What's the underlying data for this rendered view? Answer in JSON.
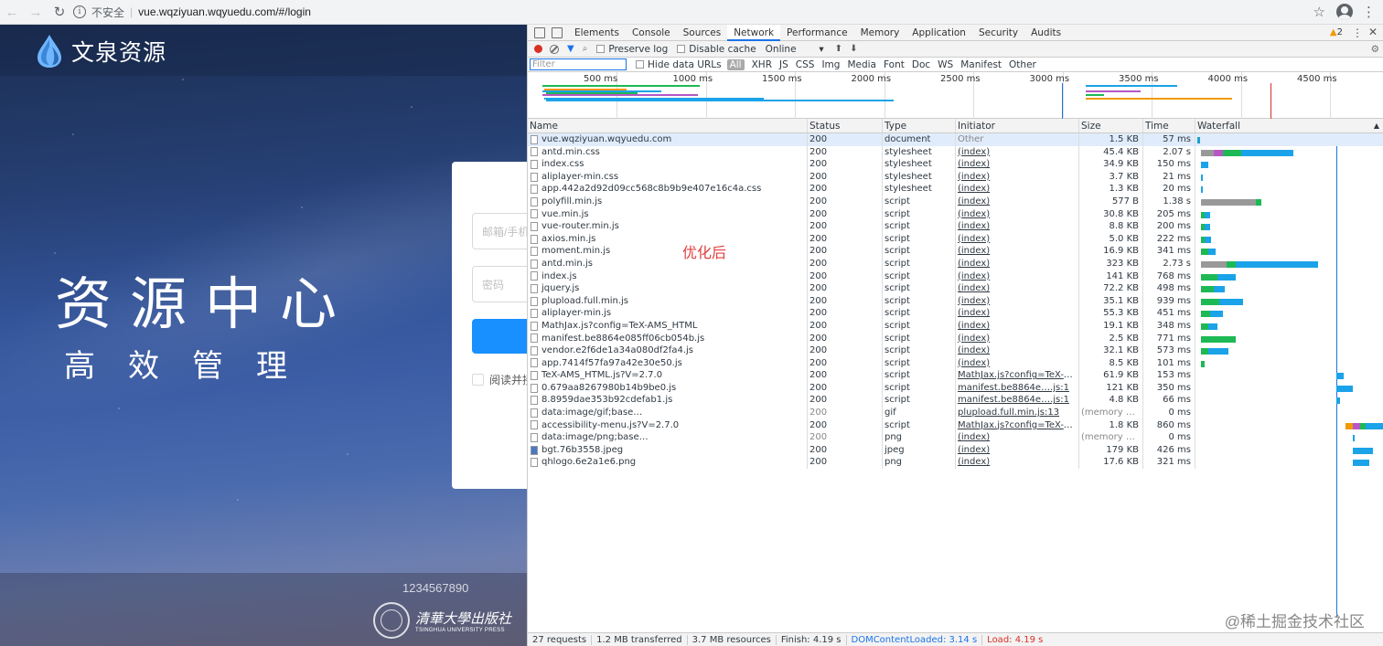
{
  "browser": {
    "insecure_label": "不安全",
    "url": "vue.wqziyuan.wqyuedu.com/#/login"
  },
  "page": {
    "brand_name": "文泉资源",
    "hero_line1": "资源中心",
    "hero_line2": "高效管理",
    "email_placeholder": "邮箱/手机",
    "password_placeholder": "密码",
    "agree_text": "阅读并接",
    "phone": "1234567890",
    "press_cn": "清華大學出版社",
    "press_en": "TSINGHUA UNIVERSITY PRESS"
  },
  "devtools": {
    "tabs": [
      "Elements",
      "Console",
      "Sources",
      "Network",
      "Performance",
      "Memory",
      "Application",
      "Security",
      "Audits"
    ],
    "warning_count": "2",
    "preserve_log": "Preserve log",
    "disable_cache": "Disable cache",
    "throttle": "Online",
    "filter_placeholder": "Filter",
    "hide_data_urls": "Hide data URLs",
    "types": [
      "All",
      "XHR",
      "JS",
      "CSS",
      "Img",
      "Media",
      "Font",
      "Doc",
      "WS",
      "Manifest",
      "Other"
    ],
    "overview_ticks": [
      "500 ms",
      "1000 ms",
      "1500 ms",
      "2000 ms",
      "2500 ms",
      "3000 ms",
      "3500 ms",
      "4000 ms",
      "4500 ms"
    ],
    "columns": {
      "name": "Name",
      "status": "Status",
      "type": "Type",
      "initiator": "Initiator",
      "size": "Size",
      "time": "Time",
      "waterfall": "Waterfall"
    },
    "rows": [
      {
        "name": "vue.wqziyuan.wqyuedu.com",
        "status": "200",
        "type": "document",
        "initiator": "Other",
        "size": "1.5 KB",
        "time": "57 ms"
      },
      {
        "name": "antd.min.css",
        "status": "200",
        "type": "stylesheet",
        "initiator": "(index)",
        "size": "45.4 KB",
        "time": "2.07 s"
      },
      {
        "name": "index.css",
        "status": "200",
        "type": "stylesheet",
        "initiator": "(index)",
        "size": "34.9 KB",
        "time": "150 ms"
      },
      {
        "name": "aliplayer-min.css",
        "status": "200",
        "type": "stylesheet",
        "initiator": "(index)",
        "size": "3.7 KB",
        "time": "21 ms"
      },
      {
        "name": "app.442a2d92d09cc568c8b9b9e407e16c4a.css",
        "status": "200",
        "type": "stylesheet",
        "initiator": "(index)",
        "size": "1.3 KB",
        "time": "20 ms"
      },
      {
        "name": "polyfill.min.js",
        "status": "200",
        "type": "script",
        "initiator": "(index)",
        "size": "577 B",
        "time": "1.38 s"
      },
      {
        "name": "vue.min.js",
        "status": "200",
        "type": "script",
        "initiator": "(index)",
        "size": "30.8 KB",
        "time": "205 ms"
      },
      {
        "name": "vue-router.min.js",
        "status": "200",
        "type": "script",
        "initiator": "(index)",
        "size": "8.8 KB",
        "time": "200 ms"
      },
      {
        "name": "axios.min.js",
        "status": "200",
        "type": "script",
        "initiator": "(index)",
        "size": "5.0 KB",
        "time": "222 ms"
      },
      {
        "name": "moment.min.js",
        "status": "200",
        "type": "script",
        "initiator": "(index)",
        "size": "16.9 KB",
        "time": "341 ms"
      },
      {
        "name": "antd.min.js",
        "status": "200",
        "type": "script",
        "initiator": "(index)",
        "size": "323 KB",
        "time": "2.73 s"
      },
      {
        "name": "index.js",
        "status": "200",
        "type": "script",
        "initiator": "(index)",
        "size": "141 KB",
        "time": "768 ms"
      },
      {
        "name": "jquery.js",
        "status": "200",
        "type": "script",
        "initiator": "(index)",
        "size": "72.2 KB",
        "time": "498 ms"
      },
      {
        "name": "plupload.full.min.js",
        "status": "200",
        "type": "script",
        "initiator": "(index)",
        "size": "35.1 KB",
        "time": "939 ms"
      },
      {
        "name": "aliplayer-min.js",
        "status": "200",
        "type": "script",
        "initiator": "(index)",
        "size": "55.3 KB",
        "time": "451 ms"
      },
      {
        "name": "MathJax.js?config=TeX-AMS_HTML",
        "status": "200",
        "type": "script",
        "initiator": "(index)",
        "size": "19.1 KB",
        "time": "348 ms"
      },
      {
        "name": "manifest.be8864e085ff06cb054b.js",
        "status": "200",
        "type": "script",
        "initiator": "(index)",
        "size": "2.5 KB",
        "time": "771 ms"
      },
      {
        "name": "vendor.e2f6de1a34a080df2fa4.js",
        "status": "200",
        "type": "script",
        "initiator": "(index)",
        "size": "32.1 KB",
        "time": "573 ms"
      },
      {
        "name": "app.7414f57fa97a42e30e50.js",
        "status": "200",
        "type": "script",
        "initiator": "(index)",
        "size": "8.5 KB",
        "time": "101 ms"
      },
      {
        "name": "TeX-AMS_HTML.js?V=2.7.0",
        "status": "200",
        "type": "script",
        "initiator": "MathJax.js?config=TeX-AM…",
        "size": "61.9 KB",
        "time": "153 ms"
      },
      {
        "name": "0.679aa8267980b14b9be0.js",
        "status": "200",
        "type": "script",
        "initiator": "manifest.be8864e….js:1",
        "size": "121 KB",
        "time": "350 ms"
      },
      {
        "name": "8.8959dae353b92cdefab1.js",
        "status": "200",
        "type": "script",
        "initiator": "manifest.be8864e….js:1",
        "size": "4.8 KB",
        "time": "66 ms"
      },
      {
        "name": "data:image/gif;base…",
        "status": "200",
        "type": "gif",
        "initiator": "plupload.full.min.js:13",
        "size": "(memory ca…",
        "time": "0 ms"
      },
      {
        "name": "accessibility-menu.js?V=2.7.0",
        "status": "200",
        "type": "script",
        "initiator": "MathJax.js?config=TeX-AM…",
        "size": "1.8 KB",
        "time": "860 ms"
      },
      {
        "name": "data:image/png;base…",
        "status": "200",
        "type": "png",
        "initiator": "(index)",
        "size": "(memory ca…",
        "time": "0 ms"
      },
      {
        "name": "bgt.76b3558.jpeg",
        "status": "200",
        "type": "jpeg",
        "initiator": "(index)",
        "size": "179 KB",
        "time": "426 ms"
      },
      {
        "name": "qhlogo.6e2a1e6.png",
        "status": "200",
        "type": "png",
        "initiator": "(index)",
        "size": "17.6 KB",
        "time": "321 ms"
      }
    ],
    "summary": {
      "requests": "27 requests",
      "transferred": "1.2 MB transferred",
      "resources": "3.7 MB resources",
      "finish": "Finish: 4.19 s",
      "dcl": "DOMContentLoaded: 3.14 s",
      "load": "Load: 4.19 s"
    }
  },
  "annotation": "优化后",
  "watermark": "@稀土掘金技术社区"
}
